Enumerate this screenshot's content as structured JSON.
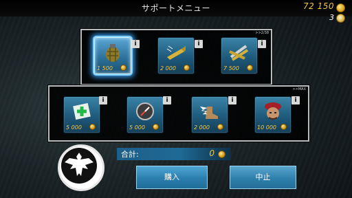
{
  "header": {
    "title": "サポートメニュー",
    "money": "72 150",
    "gold": "3"
  },
  "top_panel": {
    "tag": ">>2/38",
    "items": [
      {
        "name": "grenade",
        "price": "1 500",
        "selected": true
      },
      {
        "name": "bullets",
        "price": "2 000",
        "selected": false
      },
      {
        "name": "ammo-bundle",
        "price": "7 500",
        "selected": false
      }
    ]
  },
  "bottom_panel": {
    "tag": ">>MAX",
    "items": [
      {
        "name": "medkit",
        "price": "5 000"
      },
      {
        "name": "compass",
        "price": "5 000"
      },
      {
        "name": "winged-boot",
        "price": "2 000"
      },
      {
        "name": "soldier-beret",
        "price": "10 000"
      }
    ]
  },
  "total": {
    "label": "合計:",
    "value": "0"
  },
  "buttons": {
    "buy": "購入",
    "cancel": "中止"
  },
  "info_label": "i",
  "colors": {
    "price": "#f6c742",
    "slot": "#1e5a7b",
    "selected_glow": "#3aa6ff"
  }
}
